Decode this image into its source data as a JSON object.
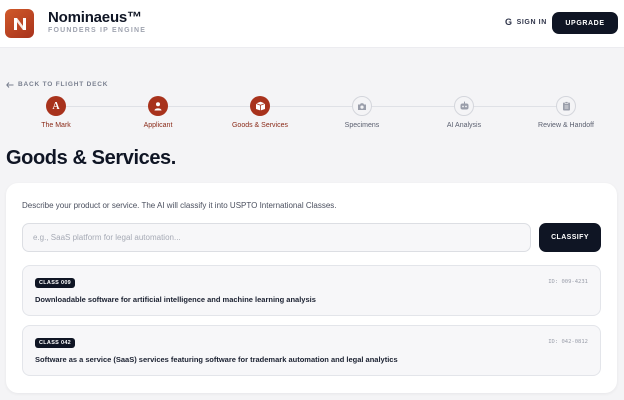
{
  "brand": {
    "name": "Nominaeus™",
    "subtitle": "FOUNDERS IP ENGINE",
    "accent": "#a8321c"
  },
  "header": {
    "signin_label": "SIGN IN",
    "signin_icon": "google-g-icon",
    "upgrade_label": "UPGRADE"
  },
  "nav": {
    "back_label": "BACK TO FLIGHT DECK",
    "back_icon": "arrow-left-icon"
  },
  "steps": [
    {
      "label": "The Mark",
      "icon": "letter-a-icon",
      "glyph": "A",
      "state": "complete"
    },
    {
      "label": "Applicant",
      "icon": "person-icon",
      "state": "complete"
    },
    {
      "label": "Goods & Services",
      "icon": "box-icon",
      "state": "current"
    },
    {
      "label": "Specimens",
      "icon": "camera-icon",
      "state": "pending"
    },
    {
      "label": "AI Analysis",
      "icon": "robot-icon",
      "state": "pending"
    },
    {
      "label": "Review & Handoff",
      "icon": "clipboard-icon",
      "state": "pending"
    }
  ],
  "page": {
    "title": "Goods & Services."
  },
  "classifier": {
    "description": "Describe your product or service. The AI will classify it into USPTO International Classes.",
    "input_value": "",
    "input_placeholder": "e.g., SaaS platform for legal automation...",
    "button_label": "CLASSIFY"
  },
  "results": [
    {
      "badge": "CLASS 009",
      "id": "ID: 009-4231",
      "description": "Downloadable software for artificial intelligence and machine learning analysis"
    },
    {
      "badge": "CLASS 042",
      "id": "ID: 042-0812",
      "description": "Software as a service (SaaS) services featuring software for trademark automation and legal analytics"
    }
  ]
}
